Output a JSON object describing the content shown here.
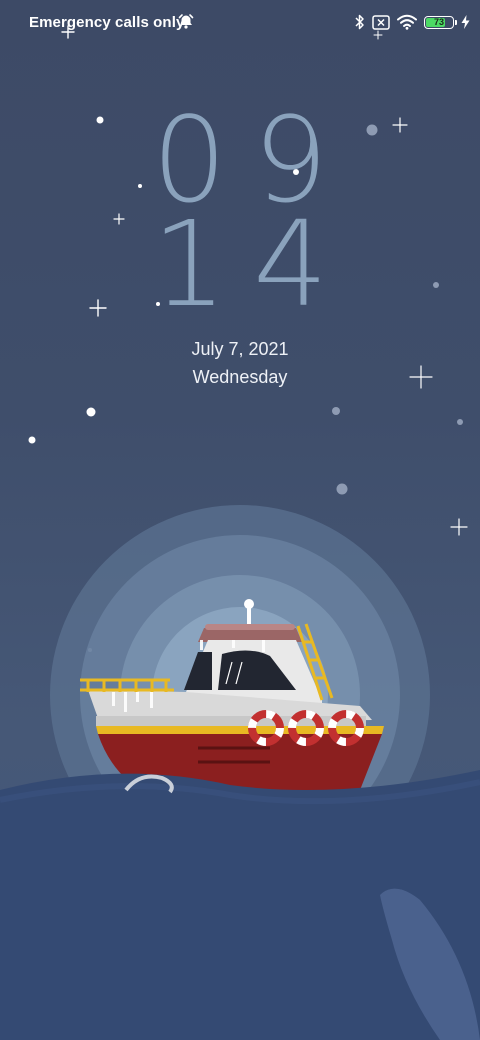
{
  "status_bar": {
    "carrier_text": "Emergency calls only",
    "battery_level": "73",
    "battery_fraction": 0.73,
    "icons": [
      "alarm-icon",
      "bluetooth-icon",
      "no-sim-icon",
      "wifi-icon",
      "battery-icon",
      "charging-bolt-icon"
    ],
    "battery_color": "#4cd964"
  },
  "lock_screen": {
    "hour": "09",
    "minute": "14",
    "date": "July 7, 2021",
    "weekday": "Wednesday",
    "clock_color": "#8aa2bc"
  },
  "wallpaper": {
    "sky_color": "#3f4e6b",
    "sea_color": "#344a73",
    "hull_color": "#8b1f1f",
    "cabin_color": "#e9e9e9",
    "accent_color": "#e8b923"
  }
}
